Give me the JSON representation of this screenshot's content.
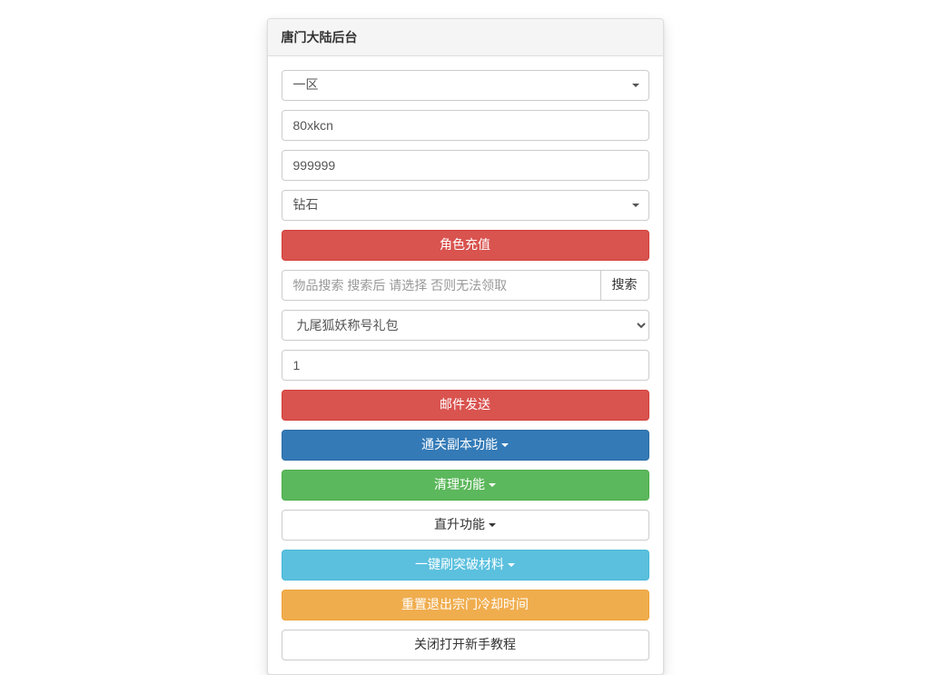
{
  "panel": {
    "title": "唐门大陆后台"
  },
  "server_select": {
    "selected": "一区"
  },
  "account_input": {
    "value": "80xkcn"
  },
  "amount_input": {
    "value": "999999"
  },
  "currency_select": {
    "selected": "钻石"
  },
  "recharge_button": "角色充值",
  "item_search": {
    "placeholder": "物品搜索 搜索后 请选择 否则无法领取",
    "button": "搜索"
  },
  "item_select": {
    "selected": "九尾狐妖称号礼包"
  },
  "quantity_input": {
    "value": "1"
  },
  "mail_button": "邮件发送",
  "dungeon_button": "通关副本功能",
  "cleanup_button": "清理功能",
  "levelup_button": "直升功能",
  "breakthrough_button": "一键刷突破材料",
  "sect_button": "重置退出宗门冷却时间",
  "tutorial_button": "关闭打开新手教程"
}
